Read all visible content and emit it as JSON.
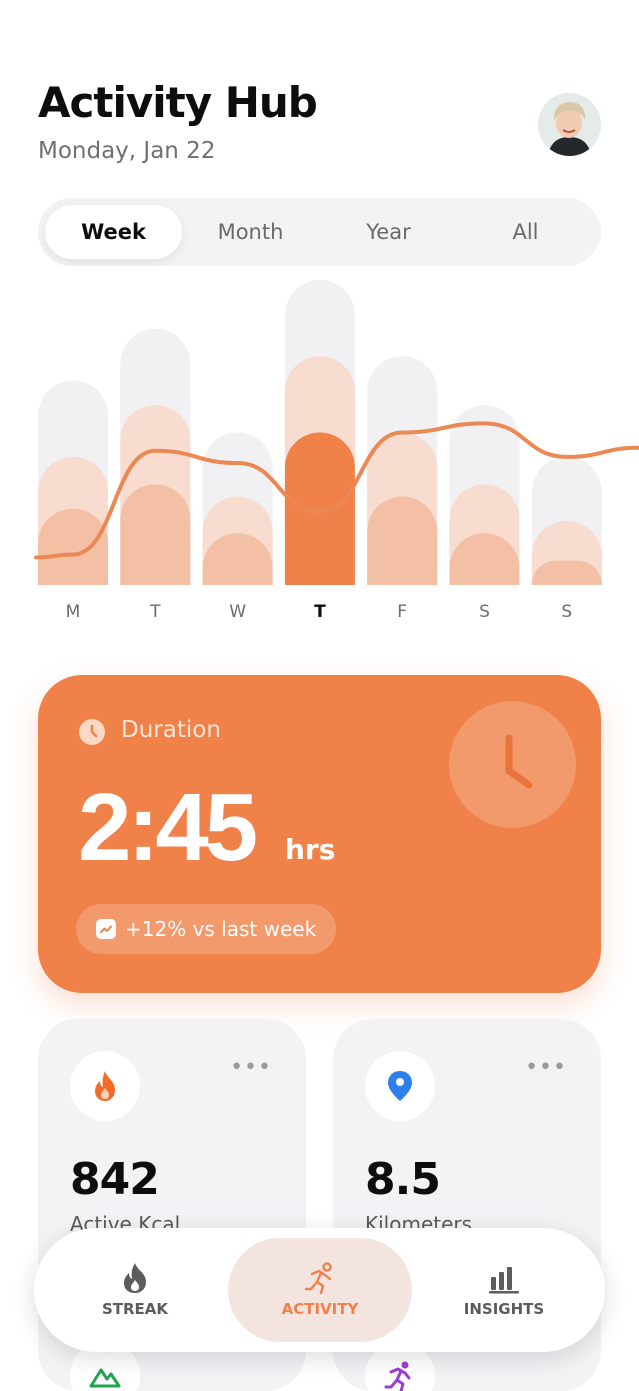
{
  "header": {
    "title": "Activity Hub",
    "date": "Monday, Jan 22"
  },
  "period_tabs": [
    "Week",
    "Month",
    "Year",
    "All"
  ],
  "period_selected": "Week",
  "chart_data": {
    "type": "bar",
    "categories": [
      "M",
      "T",
      "W",
      "T",
      "F",
      "S",
      "S"
    ],
    "highlighted_index": 3,
    "stacked_layers": [
      {
        "values": [
          0.67,
          0.84,
          0.5,
          1.0,
          0.75,
          0.59,
          0.42
        ]
      },
      {
        "values": [
          0.42,
          0.59,
          0.29,
          0.75,
          0.5,
          0.33,
          0.21
        ]
      },
      {
        "values": [
          0.25,
          0.33,
          0.17,
          0.5,
          0.29,
          0.17,
          0.08
        ]
      }
    ],
    "trend_line": [
      0.1,
      0.44,
      0.4,
      0.24,
      0.5,
      0.53,
      0.42
    ],
    "colors": {
      "back": "#f1f1f4",
      "mid": "#f7dccf",
      "front": "#f4c0a5",
      "highlight": "#f08149",
      "line": "#ec8854"
    }
  },
  "duration": {
    "label": "Duration",
    "value": "2:45",
    "unit": "hrs",
    "change": "+12% vs last week"
  },
  "stats": [
    {
      "value": "842",
      "label": "Active Kcal",
      "icon": "flame-icon",
      "color": "#f36b26"
    },
    {
      "value": "8.5",
      "label": "Kilometers",
      "icon": "location-pin-icon",
      "color": "#2f80ed"
    }
  ],
  "nav": {
    "items": [
      "STREAK",
      "ACTIVITY",
      "INSIGHTS"
    ],
    "active": "ACTIVITY"
  },
  "colors": {
    "accent": "#f08149",
    "nav_active_bg": "#f4e4df"
  }
}
